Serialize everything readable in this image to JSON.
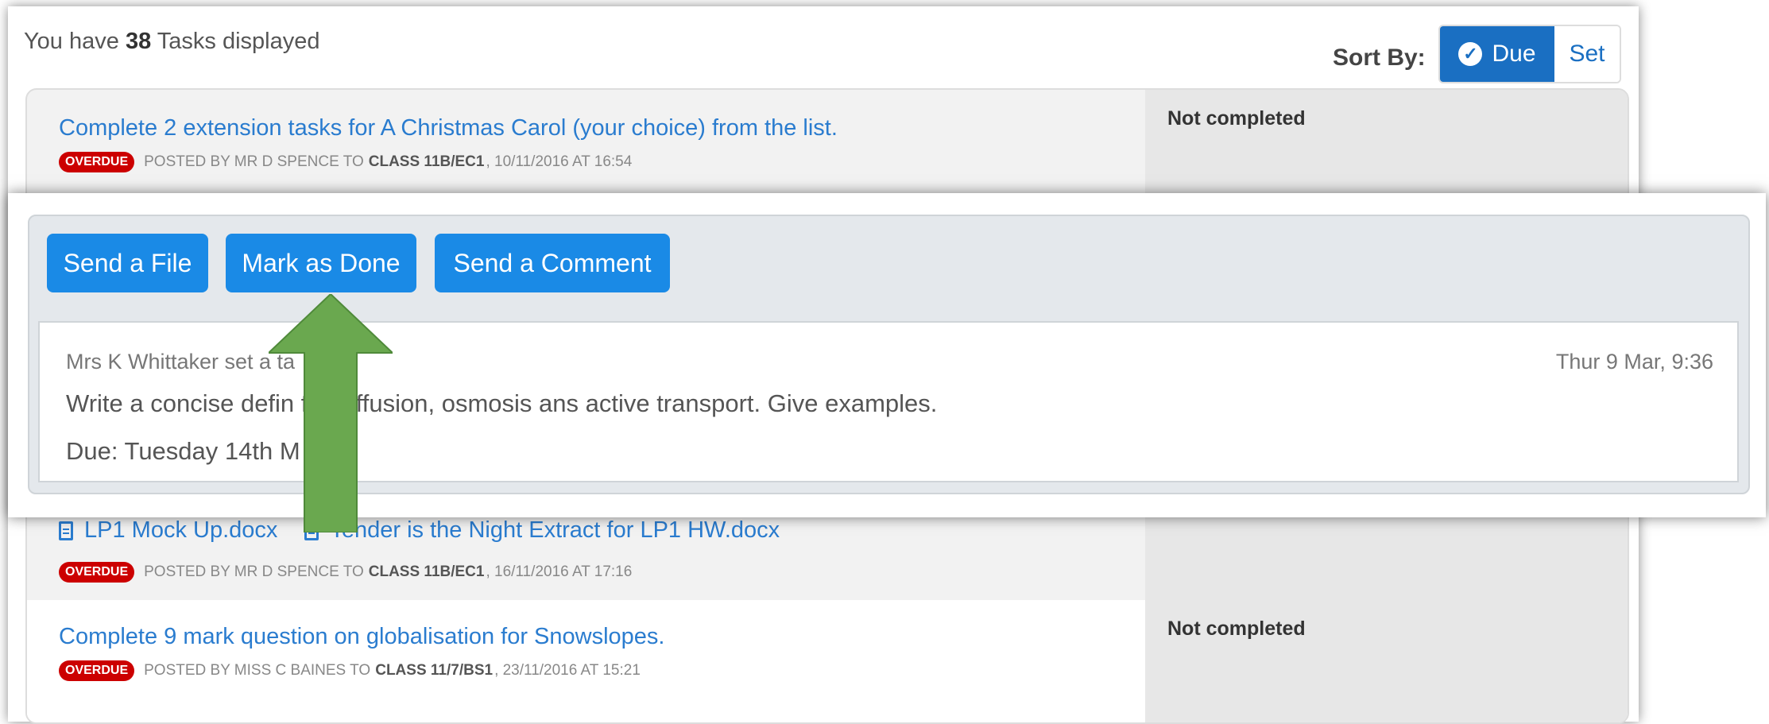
{
  "summary": {
    "prefix": "You have",
    "count": "38",
    "suffix": "Tasks displayed"
  },
  "sort": {
    "label": "Sort By:",
    "options": [
      "Due",
      "Set"
    ],
    "selected": "Due"
  },
  "tasks": [
    {
      "title": "Complete 2 extension tasks for A Christmas Carol (your choice) from the list.",
      "badge": "OVERDUE",
      "posted_prefix": "POSTED BY MR D SPENCE TO",
      "class": "CLASS 11B/EC1",
      "posted_date": ", 10/11/2016 AT 16:54",
      "status": "Not completed"
    },
    {
      "files": [
        "LP1 Mock Up.docx",
        "Tender is the Night Extract for LP1 HW.docx"
      ],
      "badge": "OVERDUE",
      "posted_prefix": "POSTED BY MR D SPENCE TO",
      "class": "CLASS 11B/EC1",
      "posted_date": ", 16/11/2016 AT 17:16"
    },
    {
      "title": "Complete 9 mark question on globalisation for Snowslopes.",
      "badge": "OVERDUE",
      "posted_prefix": "POSTED BY MISS C BAINES TO",
      "class": "CLASS 11/7/BS1",
      "posted_date": ", 23/11/2016 AT 15:21",
      "status": "Not completed"
    }
  ],
  "detail": {
    "buttons": {
      "send_file": "Send a File",
      "mark_done": "Mark as Done",
      "send_comment": "Send a Comment"
    },
    "setter": "Mrs K Whittaker set a ta",
    "timestamp": "Thur 9 Mar, 9:36",
    "body": "Write a concise defin          for diffusion, osmosis ans active transport. Give examples.",
    "due": "Due: Tuesday 14th M"
  },
  "colors": {
    "link": "#2a7ccf",
    "primary_button": "#1a8ae6",
    "sort_active": "#1a6fc2",
    "overdue_badge": "#cc0000",
    "arrow": "#6aa84f"
  },
  "icons": [
    "check-circle-icon",
    "file-icon",
    "up-arrow-icon"
  ]
}
